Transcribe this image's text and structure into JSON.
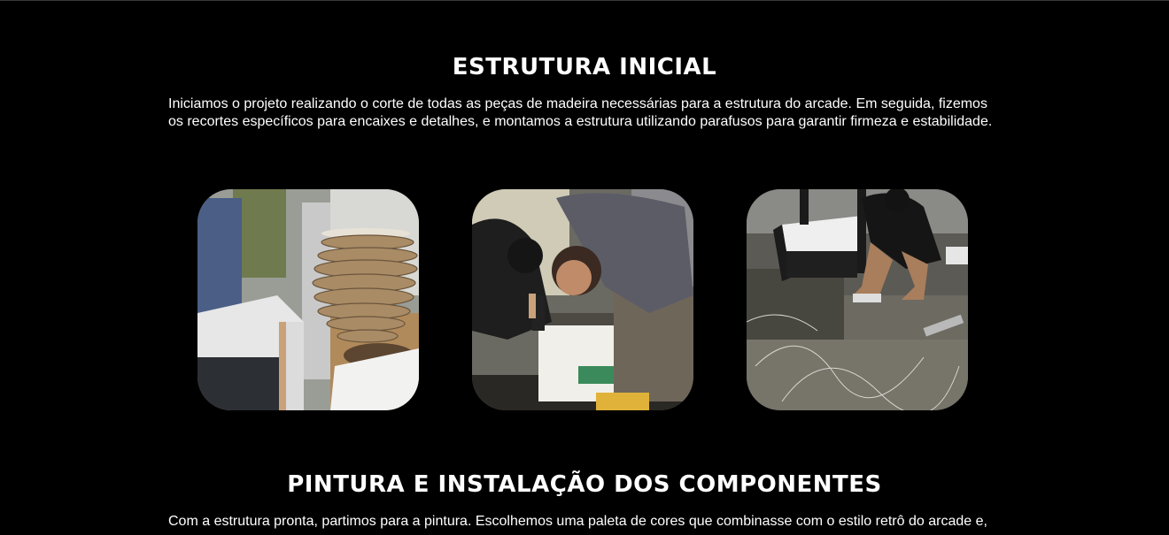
{
  "sections": [
    {
      "title": "ESTRUTURA INICIAL",
      "text": "Iniciamos o projeto realizando o corte de todas as peças de madeira necessárias para a estrutura do arcade. Em seguida, fizemos os recortes específicos para encaixes e detalhes, e montamos a estrutura utilizando parafusos para garantir firmeza e estabilidade."
    },
    {
      "title": "PINTURA E INSTALAÇÃO DOS COMPONENTES",
      "text": "Com a estrutura pronta, partimos para a pintura. Escolhemos uma paleta de cores que combinasse com o estilo retrô do arcade e,"
    }
  ],
  "gallery": [
    {
      "subject": "stacked-wood-cutouts"
    },
    {
      "subject": "drilling-cabinet"
    },
    {
      "subject": "assembling-frame"
    }
  ],
  "colors": {
    "background": "#000000",
    "text": "#ffffff"
  }
}
